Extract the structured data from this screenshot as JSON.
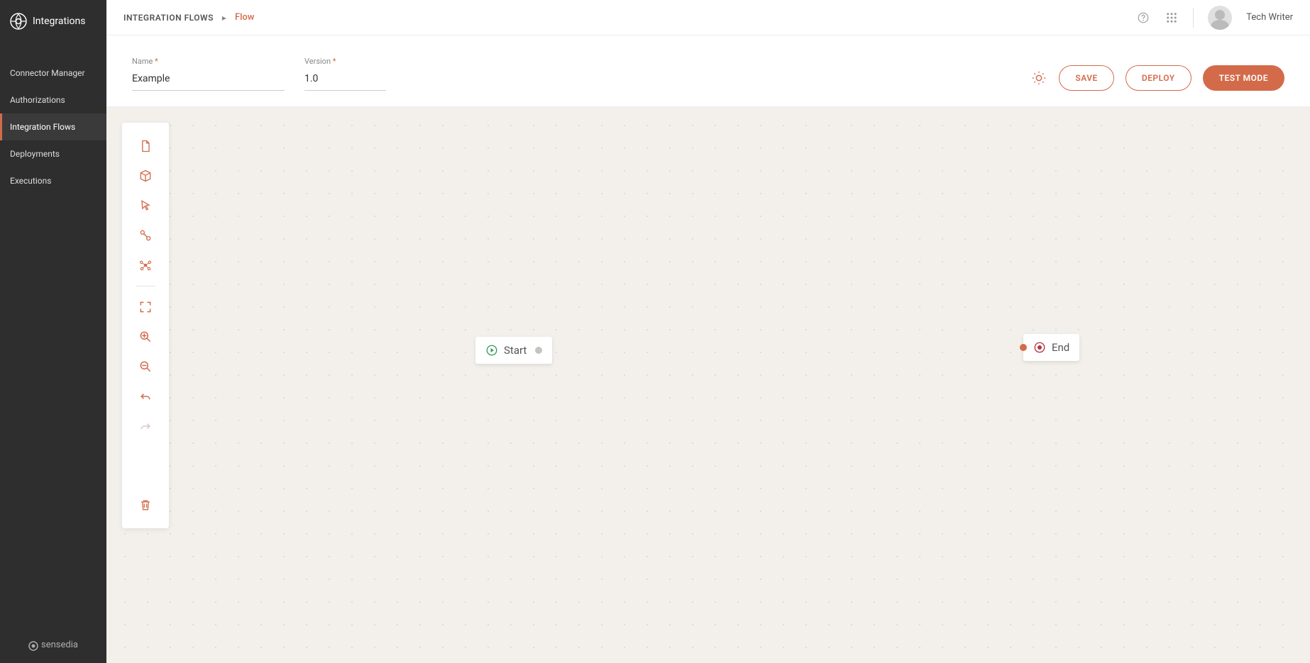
{
  "app": {
    "name": "Integrations"
  },
  "sidebar": {
    "items": [
      {
        "label": "Connector Manager"
      },
      {
        "label": "Authorizations"
      },
      {
        "label": "Integration Flows"
      },
      {
        "label": "Deployments"
      },
      {
        "label": "Executions"
      }
    ],
    "footer": "sensedia"
  },
  "breadcrumb": {
    "root": "INTEGRATION FLOWS",
    "current": "Flow"
  },
  "user": {
    "name": "Tech Writer"
  },
  "form": {
    "name_label": "Name",
    "name_value": "Example",
    "version_label": "Version",
    "version_value": "1.0"
  },
  "actions": {
    "save": "SAVE",
    "deploy": "DEPLOY",
    "test_mode": "TEST MODE"
  },
  "canvas": {
    "start_label": "Start",
    "end_label": "End"
  }
}
